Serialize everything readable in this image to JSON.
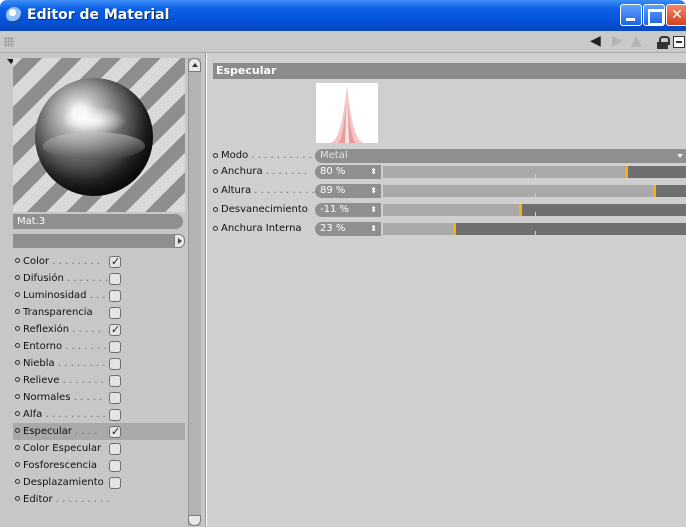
{
  "window": {
    "title": "Editor de Material"
  },
  "material": {
    "name": "Mat.3"
  },
  "channels": [
    {
      "label": "Color",
      "dots": ". . . . . . . .",
      "checked": true
    },
    {
      "label": "Difusión",
      "dots": ". . . . . . .",
      "checked": false
    },
    {
      "label": "Luminosidad",
      "dots": ". . .",
      "checked": false
    },
    {
      "label": "Transparencia",
      "dots": "",
      "checked": false
    },
    {
      "label": "Reflexión",
      "dots": ". . . . .",
      "checked": true
    },
    {
      "label": "Entorno",
      "dots": ". . . . . . .",
      "checked": false
    },
    {
      "label": "Niebla",
      "dots": ". . . . . . . .",
      "checked": false
    },
    {
      "label": "Relieve",
      "dots": ". . . . . . .",
      "checked": false
    },
    {
      "label": "Normales",
      "dots": ". . . . .",
      "checked": false
    },
    {
      "label": "Alfa",
      "dots": ". . . . . . . . . .",
      "checked": false
    },
    {
      "label": "Especular",
      "dots": ". . . .",
      "checked": true,
      "selected": true
    },
    {
      "label": "Color Especular",
      "dots": "",
      "checked": false
    },
    {
      "label": "Fosforescencia",
      "dots": "",
      "checked": false
    },
    {
      "label": "Desplazamiento",
      "dots": "",
      "checked": false
    },
    {
      "label": "Editor",
      "dots": ". . . . . . . . .",
      "checked": null
    }
  ],
  "specular": {
    "section_title": "Especular",
    "mode": {
      "label": "Modo",
      "dots": ". . . . . . . . . .",
      "value": "Metal"
    },
    "params": [
      {
        "key": "width",
        "label": "Anchura",
        "dots": ". . . . . . .",
        "value": "80 %",
        "level": 0.8
      },
      {
        "key": "height",
        "label": "Altura",
        "dots": ". . . . . . . . . .",
        "value": "89 %",
        "level": 0.89
      },
      {
        "key": "falloff",
        "label": "Desvanecimiento",
        "dots": "",
        "value": "-11 %",
        "level": 0.45
      },
      {
        "key": "inner_width",
        "label": "Anchura Interna",
        "dots": "",
        "value": "23 %",
        "level": 0.23
      }
    ]
  },
  "colors": {
    "title_bar": "#0551d8",
    "slider_thumb": "#f2b311",
    "panel_header": "#8c8c8c"
  },
  "icons": {
    "app": "app-icon",
    "minimize": "minimize-icon",
    "maximize": "maximize-icon",
    "close": "close-icon",
    "back": "arrow-left-icon",
    "forward": "arrow-right-icon",
    "up": "arrow-up-icon",
    "lock": "lock-icon",
    "new_window": "new-window-icon"
  }
}
